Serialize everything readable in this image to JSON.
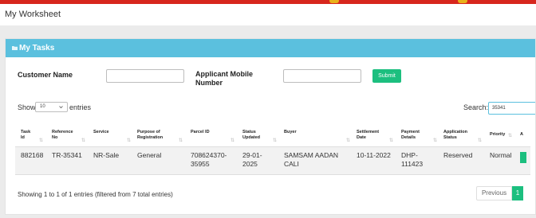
{
  "page": {
    "title": "My Worksheet"
  },
  "panel": {
    "title": "My Tasks"
  },
  "filters": {
    "customer_name_label": "Customer Name",
    "customer_name_value": "",
    "mobile_label_line1": "Applicant Mobile",
    "mobile_label_line2": "Number",
    "mobile_value": "",
    "submit_label": "Submit"
  },
  "table_controls": {
    "show_label": "Show",
    "entries_count": "10",
    "entries_label": "entries",
    "search_label": "Search:",
    "search_value": "35341"
  },
  "table": {
    "headers": [
      {
        "line1": "Task",
        "line2": "Id"
      },
      {
        "line1": "Reference",
        "line2": "No"
      },
      {
        "line1": "Service",
        "line2": ""
      },
      {
        "line1": "Purpose of",
        "line2": "Registration"
      },
      {
        "line1": "Parcel ID",
        "line2": ""
      },
      {
        "line1": "Status",
        "line2": "Updated"
      },
      {
        "line1": "Buyer",
        "line2": ""
      },
      {
        "line1": "Settlement",
        "line2": "Date"
      },
      {
        "line1": "Payment",
        "line2": "Details"
      },
      {
        "line1": "Application",
        "line2": "Status"
      },
      {
        "line1": "Priority",
        "line2": ""
      },
      {
        "line1": "A",
        "line2": ""
      }
    ],
    "rows": [
      {
        "task_id": "882168",
        "reference_no": "TR-35341",
        "service": "NR-Sale",
        "purpose": "General",
        "parcel_id_1": "708624370-",
        "parcel_id_2": "35955",
        "status_updated_1": "29-01-",
        "status_updated_2": "2025",
        "buyer_1": "SAMSAM AADAN",
        "buyer_2": "CALI",
        "settlement_date": "10-11-2022",
        "payment_1": "DHP-",
        "payment_2": "111423",
        "application_status": "Reserved",
        "priority": "Normal"
      }
    ]
  },
  "footer": {
    "info": "Showing 1 to 1 of 1 entries (filtered from 7 total entries)",
    "previous_label": "Previous",
    "current_page": "1"
  },
  "colors": {
    "header_bar": "#5bc0de",
    "accent_green": "#1cbf7f",
    "top_strip": "#d7261d"
  },
  "icons": {
    "panel_title_icon": "folder-icon",
    "select_chevron": "chevron-down-icon",
    "sort": "sort-icon"
  }
}
